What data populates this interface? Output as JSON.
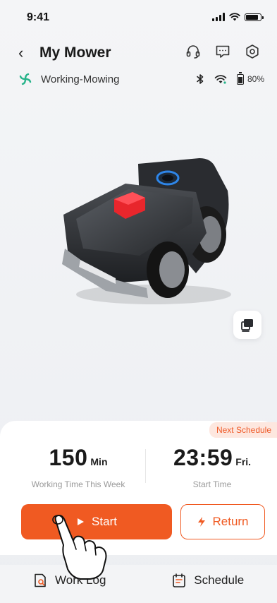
{
  "status_bar": {
    "time": "9:41"
  },
  "header": {
    "title": "My Mower",
    "back_glyph": "‹"
  },
  "device_status": {
    "state": "Working-Mowing",
    "battery": "80%"
  },
  "card": {
    "badge": "Next Schedule",
    "working_time_value": "150",
    "working_time_unit": "Min",
    "working_time_label": "Working Time This Week",
    "start_time_value": "23:59",
    "start_time_day": "Fri.",
    "start_time_label": "Start Time"
  },
  "actions": {
    "start_label": "Start",
    "return_label": "Return"
  },
  "tabs": [
    {
      "label": "Work Log",
      "icon": "work-log-icon"
    },
    {
      "label": "Schedule",
      "icon": "schedule-icon"
    }
  ],
  "colors": {
    "accent": "#f05a22",
    "status_green": "#27b38a",
    "badge_bg": "#fde7df"
  }
}
